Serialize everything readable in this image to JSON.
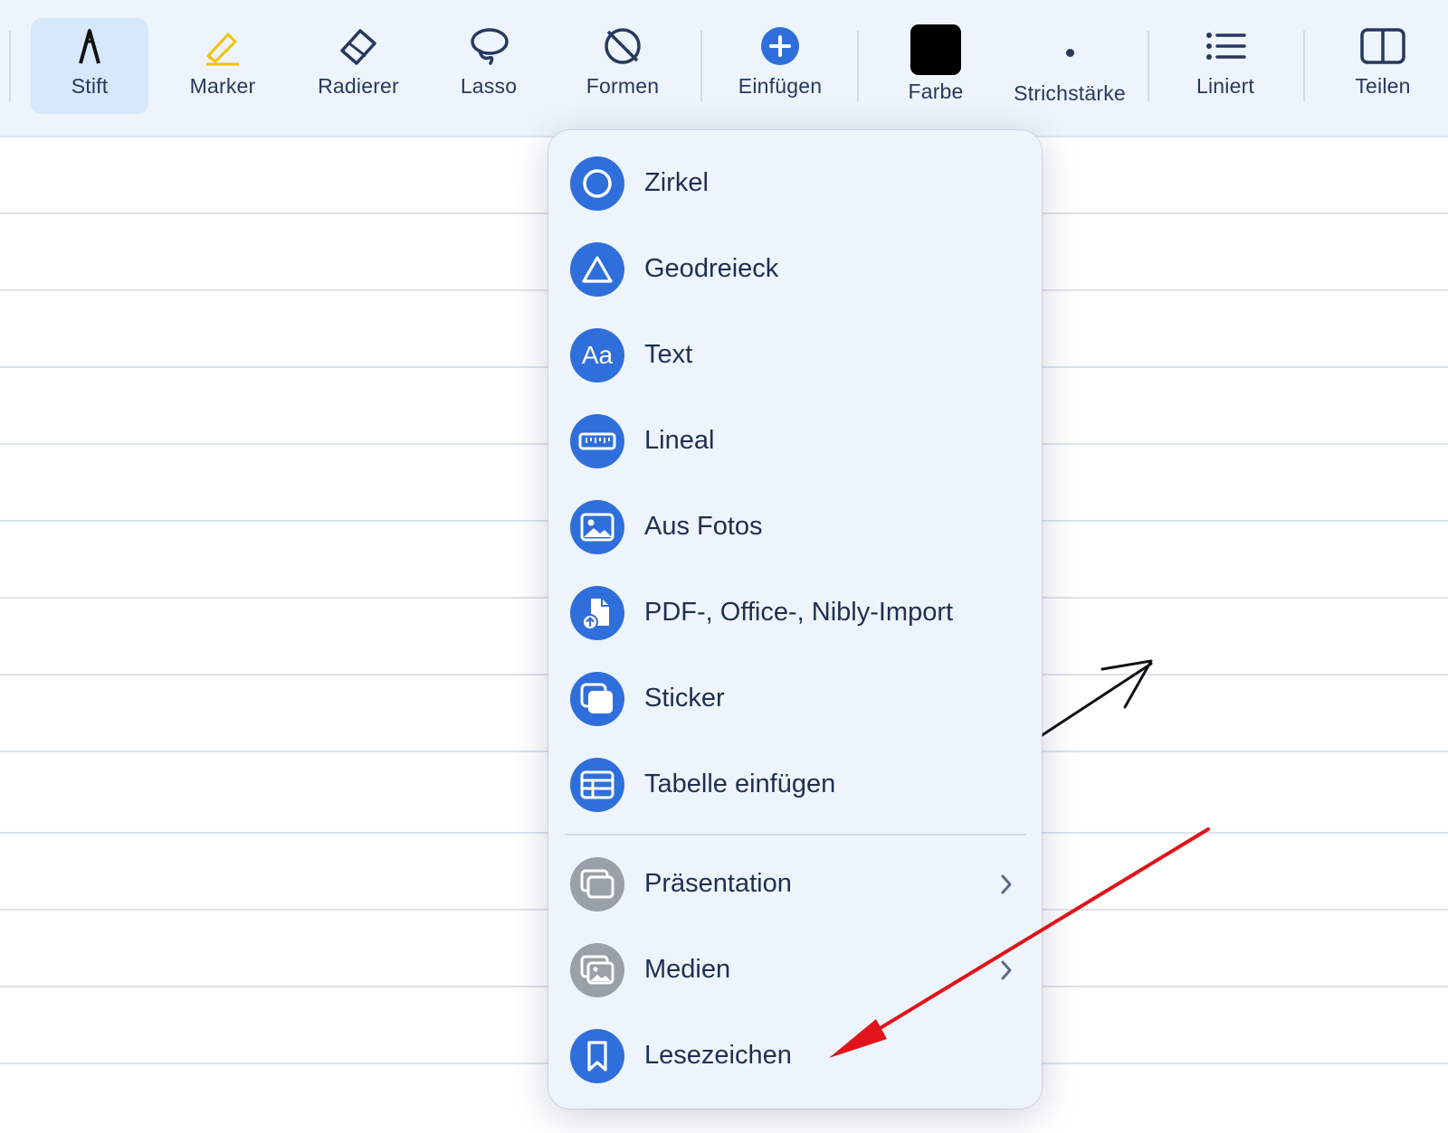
{
  "toolbar": {
    "tools": [
      {
        "label": "Stift",
        "icon": "pen-icon",
        "active": true
      },
      {
        "label": "Marker",
        "icon": "highlighter-icon"
      },
      {
        "label": "Radierer",
        "icon": "eraser-icon"
      },
      {
        "label": "Lasso",
        "icon": "lasso-icon"
      },
      {
        "label": "Formen",
        "icon": "shapes-icon"
      },
      {
        "label": "Einfügen",
        "icon": "plus-circle-icon"
      },
      {
        "label": "Farbe",
        "icon": "color-swatch-icon"
      },
      {
        "label": "Strichstärke",
        "icon": "stroke-dot-icon"
      },
      {
        "label": "Liniert",
        "icon": "list-lines-icon"
      },
      {
        "label": "Teilen",
        "icon": "split-view-icon"
      }
    ],
    "colors": {
      "marker": "#f2c400",
      "accent": "#2f6fdb",
      "color_swatch": "#000000"
    }
  },
  "insert_menu": {
    "items": [
      {
        "label": "Zirkel",
        "icon": "compass-circle-icon"
      },
      {
        "label": "Geodreieck",
        "icon": "triangle-icon"
      },
      {
        "label": "Text",
        "icon": "text-aa-icon"
      },
      {
        "label": "Lineal",
        "icon": "ruler-icon"
      },
      {
        "label": "Aus Fotos",
        "icon": "photo-icon"
      },
      {
        "label": "PDF-, Office-, Nibly-Import",
        "icon": "document-import-icon"
      },
      {
        "label": "Sticker",
        "icon": "sticker-icon"
      },
      {
        "label": "Tabelle einfügen",
        "icon": "table-icon"
      }
    ],
    "secondary_items": [
      {
        "label": "Präsentation",
        "icon": "presentation-icon",
        "has_submenu": true,
        "disabled": true
      },
      {
        "label": "Medien",
        "icon": "media-icon",
        "has_submenu": true,
        "disabled": true
      },
      {
        "label": "Lesezeichen",
        "icon": "bookmark-icon"
      }
    ]
  },
  "annotation": {
    "arrow_color": "#e0141a"
  }
}
